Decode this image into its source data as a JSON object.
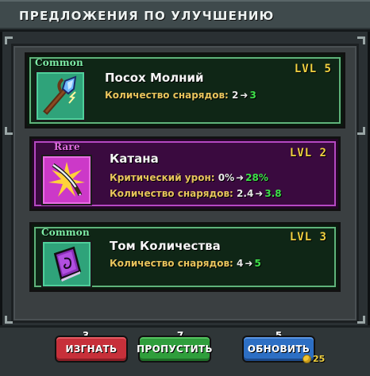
{
  "window": {
    "title": "ПРЕДЛОЖЕНИЯ ПО УЛУЧШЕНИЮ"
  },
  "offers": [
    {
      "rarity": "Common",
      "name": "Посох Молний",
      "level": "LVL 5",
      "icon": "lightning-staff-icon",
      "stats": [
        {
          "label": "Количество снарядов:",
          "from": "2",
          "to": "3"
        }
      ]
    },
    {
      "rarity": "Rare",
      "name": "Катана",
      "level": "LVL 2",
      "icon": "katana-icon",
      "stats": [
        {
          "label": "Критический урон:",
          "from": "0%",
          "to": "28%"
        },
        {
          "label": "Количество снарядов:",
          "from": "2.4",
          "to": "3.8"
        }
      ]
    },
    {
      "rarity": "Common",
      "name": "Том Количества",
      "level": "LVL 3",
      "icon": "spell-tome-icon",
      "stats": [
        {
          "label": "Количество снарядов:",
          "from": "4",
          "to": "5"
        }
      ]
    }
  ],
  "actions": {
    "banish": {
      "label": "ИЗГНАТЬ",
      "count": "3"
    },
    "skip": {
      "label": "ПРОПУСТИТЬ",
      "count": "7"
    },
    "refresh": {
      "label": "ОБНОВИТЬ",
      "count": "5",
      "cost": "25",
      "cost_icon": "coin-icon"
    }
  },
  "colors": {
    "common_border": "#5fb37a",
    "rare_border": "#b548c2",
    "level": "#f0d040",
    "stat_label": "#e8c45c",
    "stat_upgrade": "#3ee04a"
  }
}
